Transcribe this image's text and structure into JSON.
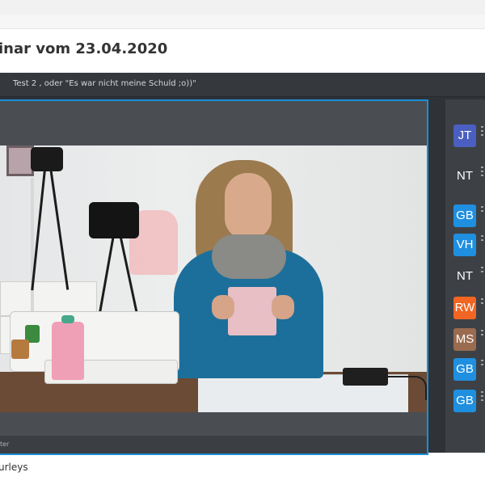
{
  "page": {
    "title": "inar vom 23.04.2020",
    "footer_text": "urleys"
  },
  "session": {
    "title": "Test 2 , oder \"Es war nicht meine Schuld ;o))\""
  },
  "video": {
    "bottom_label": "ter"
  },
  "participants": [
    {
      "initials": "JT",
      "color": "#4a5fc1"
    },
    {
      "initials": "NT",
      "color": "#3d4146"
    },
    {
      "initials": "GB",
      "color": "#1f8fe0"
    },
    {
      "initials": "VH",
      "color": "#1f8fe0"
    },
    {
      "initials": "NT",
      "color": "#3d4146"
    },
    {
      "initials": "RW",
      "color": "#f26522"
    },
    {
      "initials": "MS",
      "color": "#9a6b4f"
    },
    {
      "initials": "GB",
      "color": "#1f8fe0"
    },
    {
      "initials": "GB",
      "color": "#1f8fe0"
    }
  ],
  "colors": {
    "accent": "#1a8fd6",
    "player_bg": "#2f3237"
  }
}
